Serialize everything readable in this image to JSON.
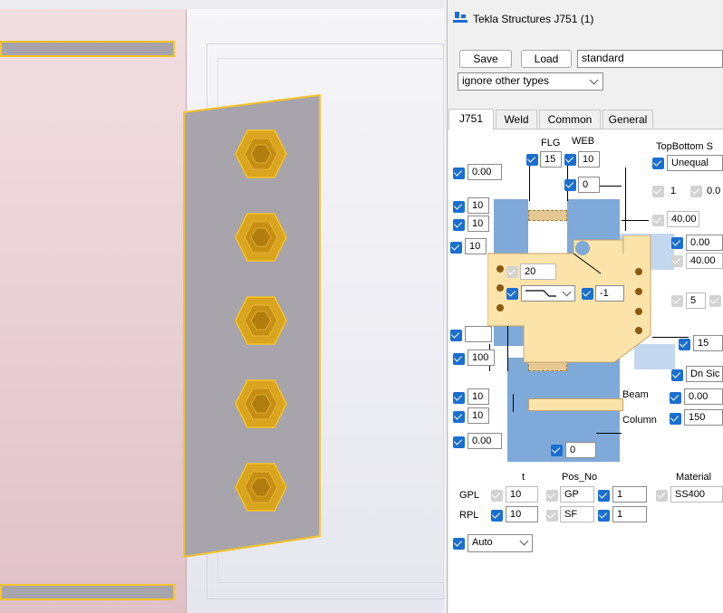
{
  "dialog": {
    "title": "Tekla Structures  J751 (1)",
    "save_label": "Save",
    "load_label": "Load",
    "preset_value": "standard",
    "filter_value": "ignore other types",
    "tabs": [
      "J751",
      "Weld",
      "Common",
      "General"
    ]
  },
  "drawing": {
    "flg_label": "FLG",
    "web_label": "WEB",
    "flg_value": "15",
    "web_value": "10",
    "topbottom_label": "TopBottom S",
    "topbottom_value": "Unequal",
    "left_top_offset": "0.00",
    "mid_top_value": "0",
    "right_col_1": "1",
    "right_col_2": "0.0",
    "right_col_3": "40.00",
    "left_10_a": "10",
    "left_10_b": "10",
    "left_10_c": "10",
    "right_col_4": "0.00",
    "right_col_5": "40.00",
    "inner_20": "20",
    "shape_minus1": "-1",
    "right_5": "5",
    "left_blank": "",
    "right_15": "15",
    "left_100": "100",
    "dn_side": "Dn Sic",
    "left_10_d": "10",
    "left_10_e": "10",
    "beam_label": "Beam",
    "column_label": "Column",
    "right_000": "0.00",
    "right_150": "150",
    "left_bottom_offset": "0.00",
    "bottom_0": "0"
  },
  "table": {
    "headers": {
      "t": "t",
      "pos_no": "Pos_No",
      "material": "Material"
    },
    "rows": [
      {
        "name": "GPL",
        "t": "10",
        "pos": "GP",
        "num": "1",
        "material": "SS400"
      },
      {
        "name": "RPL",
        "t": "10",
        "pos": "SF",
        "num": "1",
        "material": ""
      }
    ]
  },
  "auto_value": "Auto",
  "colors": {
    "accent": "#1a6fcf",
    "plate": "#a7a4ab",
    "bolt": "#d4a017",
    "highlight": "#f7c327"
  }
}
